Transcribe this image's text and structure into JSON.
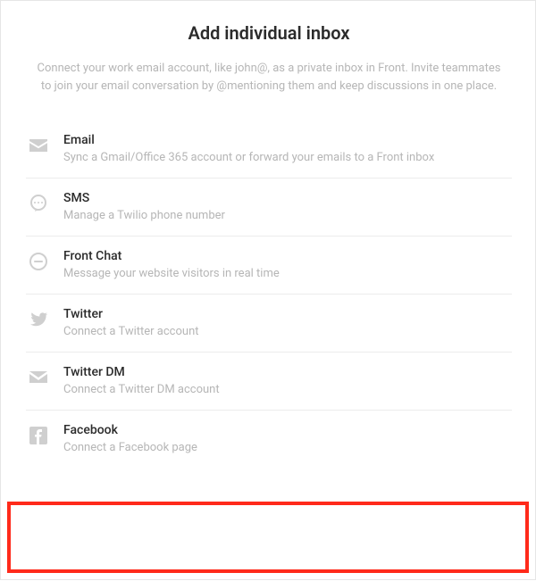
{
  "header": {
    "title": "Add individual inbox",
    "subtitle": "Connect your work email account, like john@, as a private inbox in Front. Invite teammates to join your email conversation by @mentioning them and keep discussions in one place."
  },
  "options": [
    {
      "id": "email",
      "label": "Email",
      "desc": "Sync a Gmail/Office 365 account or forward your emails to a Front inbox",
      "icon": "email-icon"
    },
    {
      "id": "sms",
      "label": "SMS",
      "desc": "Manage a Twilio phone number",
      "icon": "sms-icon"
    },
    {
      "id": "front-chat",
      "label": "Front Chat",
      "desc": "Message your website visitors in real time",
      "icon": "front-chat-icon"
    },
    {
      "id": "twitter",
      "label": "Twitter",
      "desc": "Connect a Twitter account",
      "icon": "twitter-icon"
    },
    {
      "id": "twitter-dm",
      "label": "Twitter DM",
      "desc": "Connect a Twitter DM account",
      "icon": "twitter-dm-icon"
    },
    {
      "id": "facebook",
      "label": "Facebook",
      "desc": "Connect a Facebook page",
      "icon": "facebook-icon"
    }
  ],
  "highlighted_option": "facebook",
  "colors": {
    "text_primary": "#2b2b2b",
    "text_secondary": "#b6b6b6",
    "icon": "#cfcfcf",
    "divider": "#ececec",
    "highlight_border": "#ff2a1a"
  }
}
